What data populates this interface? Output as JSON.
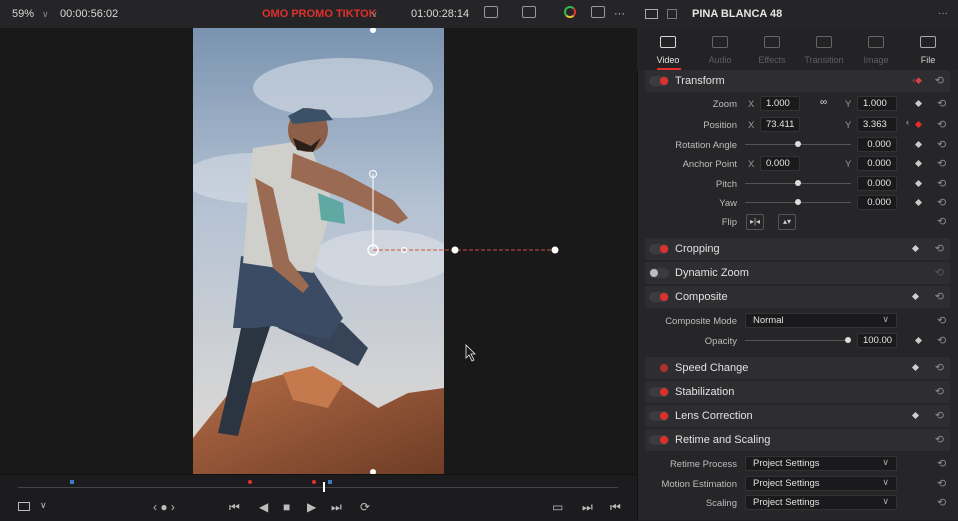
{
  "topbar": {
    "zoom": "59%",
    "zoom_chevron": "∨",
    "timecode_left": "00:00:56:02",
    "timeline_name": "OMO PROMO TIKTOK",
    "timeline_chevron": "∨",
    "timecode_right": "01:00:28:14",
    "more": "···",
    "accent_color": "#e0302e"
  },
  "inspector": {
    "clip_name": "PINA BLANCA 48",
    "more": "···",
    "tabs": [
      {
        "label": "Video",
        "icon": "film-icon",
        "active": true
      },
      {
        "label": "Audio",
        "icon": "music-note-icon",
        "active": false
      },
      {
        "label": "Effects",
        "icon": "magic-wand-icon",
        "active": false
      },
      {
        "label": "Transition",
        "icon": "transition-icon",
        "active": false
      },
      {
        "label": "Image",
        "icon": "image-icon",
        "active": false
      },
      {
        "label": "File",
        "icon": "file-icon",
        "active": false
      }
    ],
    "transform": {
      "title": "Transform",
      "zoom_label": "Zoom",
      "zoom_x": "1.000",
      "zoom_y": "1.000",
      "position_label": "Position",
      "position_x": "73.411",
      "position_y": "3.363",
      "rotation_label": "Rotation Angle",
      "rotation_value": "0.000",
      "anchor_label": "Anchor Point",
      "anchor_x": "0.000",
      "anchor_y": "0.000",
      "pitch_label": "Pitch",
      "pitch_value": "0.000",
      "yaw_label": "Yaw",
      "yaw_value": "0.000",
      "flip_label": "Flip",
      "x_axis": "X",
      "y_axis": "Y"
    },
    "sections": {
      "cropping": "Cropping",
      "dynamic_zoom": "Dynamic Zoom",
      "composite": "Composite",
      "speed_change": "Speed Change",
      "stabilization": "Stabilization",
      "lens_correction": "Lens Correction",
      "retime_scaling": "Retime and Scaling"
    },
    "composite": {
      "mode_label": "Composite Mode",
      "mode_value": "Normal",
      "opacity_label": "Opacity",
      "opacity_value": "100.00"
    },
    "retime": {
      "process_label": "Retime Process",
      "process_value": "Project Settings",
      "motion_label": "Motion Estimation",
      "motion_value": "Project Settings",
      "scaling_label": "Scaling",
      "scaling_value": "Project Settings"
    }
  },
  "icons": {
    "reset": "⟲",
    "chevron": "∨",
    "link": "🔗"
  }
}
